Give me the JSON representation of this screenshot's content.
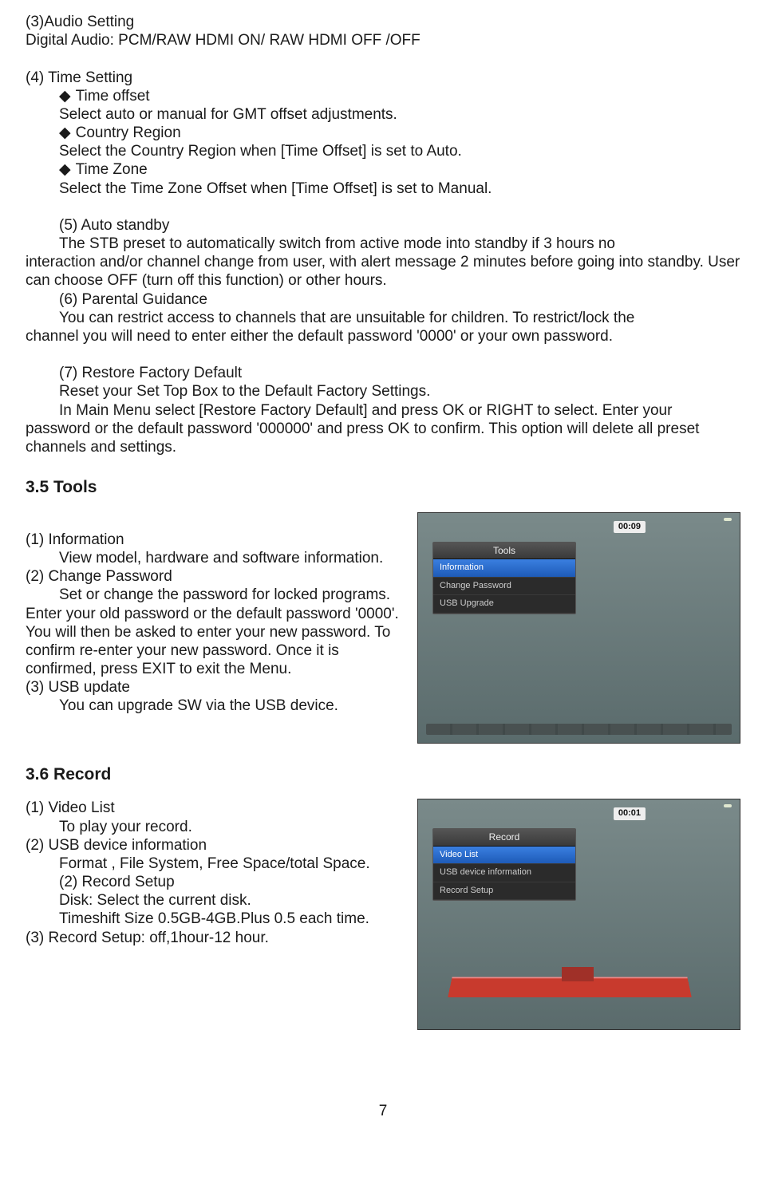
{
  "s3": {
    "title": "(3)Audio Setting",
    "digital_audio": "Digital Audio: PCM/RAW HDMI ON/ RAW HDMI OFF /OFF"
  },
  "s4": {
    "title": "(4) Time Setting",
    "bullet1_label": "Time offset",
    "bullet1_text": "Select auto or manual for GMT offset adjustments.",
    "bullet2_label": "Country Region",
    "bullet2_text": "Select the Country Region when [Time Offset] is set to Auto.",
    "bullet3_label": "Time Zone",
    "bullet3_text": "Select the Time Zone Offset when [Time Offset] is set to Manual."
  },
  "s5": {
    "title_line": "(5)   Auto standby",
    "p1a": "The STB preset to automatically switch from active mode into standby if 3 hours no ",
    "p1b": "interaction and/or channel change from user, with alert message 2 minutes before going into standby. User can choose OFF (turn off this function) or other hours."
  },
  "s6": {
    "title": "(6) Parental Guidance",
    "p1a": "You can restrict access to channels that are unsuitable for children. To restrict/lock the ",
    "p1b": "channel you will need to enter either the default password '0000' or your own password."
  },
  "s7": {
    "title": "(7) Restore Factory Default",
    "l1": "Reset your Set Top Box to the Default Factory Settings.",
    "l2a": "In Main Menu select [Restore Factory Default] and press OK or RIGHT to select. Enter your ",
    "l2b": "password or the default password '000000' and press OK to confirm. This option will delete all preset channels and settings."
  },
  "tools": {
    "heading": "3.5 Tools",
    "i1_title": "(1) Information",
    "i1_text": "View model, hardware and software information.",
    "i2_title": "(2) Change Password",
    "i2_text": "Set or change the password for locked programs. Enter your old password or the default password '0000'. You will then be asked to enter your new password. To confirm re-enter your new password. Once it is confirmed, press EXIT to exit the Menu.",
    "i3_title": "(3) USB update",
    "i3_text": "You can upgrade SW via the USB device.",
    "menu_title": "Tools",
    "menu_items": [
      "Information",
      "Change Password",
      "USB Upgrade"
    ],
    "timecode": "00:09"
  },
  "record": {
    "heading": "3.6 Record",
    "i1_title": "(1)  Video List",
    "i1_text": "To play your record.",
    "i2_title": "(2)  USB device information",
    "i2_text": "Format , File System, Free Space/total Space.",
    "i2b_title": "(2) Record Setup",
    "i2b_l1": "Disk: Select the current disk.",
    "i2b_l2": "Timeshift Size 0.5GB-4GB.Plus 0.5 each time.",
    "i3_title": "(3)  Record Setup: off,1hour-12 hour.",
    "menu_title": "Record",
    "menu_items": [
      "Video List",
      "USB device information",
      "Record Setup"
    ],
    "timecode": "00:01"
  },
  "page_number": "7"
}
